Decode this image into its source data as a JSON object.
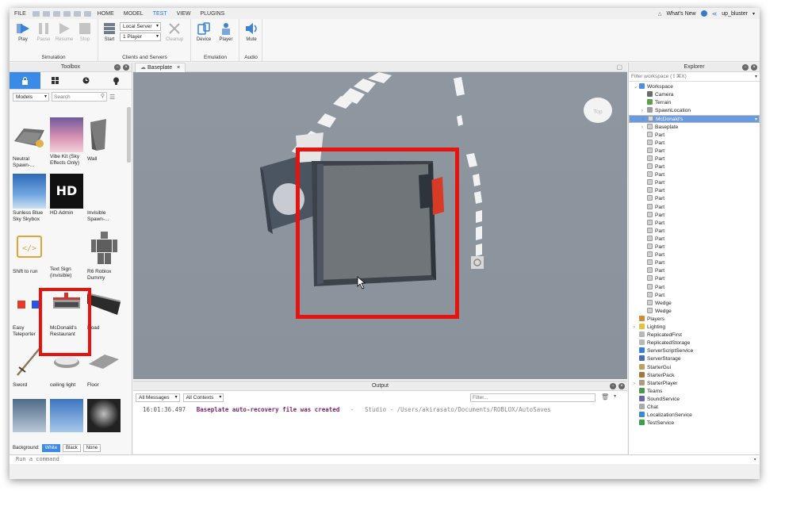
{
  "menu": {
    "file": "FILE",
    "tabs": [
      "HOME",
      "MODEL",
      "TEST",
      "VIEW",
      "PLUGINS"
    ],
    "active_tab": "TEST",
    "whats_new": "What's New",
    "username": "up_bluster"
  },
  "ribbon": {
    "play": "Play",
    "pause": "Pause",
    "resume": "Resume",
    "stop": "Stop",
    "simulation_label": "Simulation",
    "start": "Start",
    "server_select": "Local Server",
    "players_select": "1 Player",
    "cleanup": "Cleanup",
    "clients_label": "Clients and Servers",
    "device": "Device",
    "player": "Player",
    "emulation_label": "Emulation",
    "mute": "Mute",
    "audio_label": "Audio"
  },
  "toolbox": {
    "title": "Toolbox",
    "category": "Models",
    "search_placeholder": "Search",
    "items": [
      {
        "label": "Neutral Spawn-..."
      },
      {
        "label": "Vibe Kit (Sky Effects Only)"
      },
      {
        "label": "Wall"
      },
      {
        "label": "Sunless Blue Sky Skybox"
      },
      {
        "label": "HD Admin"
      },
      {
        "label": "Invisible Spawn-..."
      },
      {
        "label": "Shift to run"
      },
      {
        "label": "Text Sign (invisible)"
      },
      {
        "label": "R6 Roblox Dummy"
      },
      {
        "label": "Easy Teleporter"
      },
      {
        "label": "McDonald's Restaurant"
      },
      {
        "label": "Road"
      },
      {
        "label": "Sword"
      },
      {
        "label": "ceiling light"
      },
      {
        "label": "Floor"
      }
    ],
    "thumb_text_hd": "HD",
    "background_label": "Background:",
    "bg_white": "White",
    "bg_black": "Black",
    "bg_none": "None"
  },
  "viewport": {
    "tab_label": "Baseplate"
  },
  "output": {
    "title": "Output",
    "messages_filter": "All Messages",
    "contexts_filter": "All Contexts",
    "filter_placeholder": "Filter...",
    "line": {
      "time": "16:01:36.497",
      "message": "Baseplate auto-recovery file was created",
      "separator": "-",
      "source": "Studio - /Users/akirasato/Documents/ROBLOX/AutoSaves"
    }
  },
  "explorer": {
    "title": "Explorer",
    "filter_placeholder": "Filter workspace (⇧⌘X)",
    "tree": [
      {
        "label": "Workspace",
        "depth": 0,
        "arrow": "⌄",
        "icon": "workspace",
        "selected": false
      },
      {
        "label": "Camera",
        "depth": 1,
        "arrow": "",
        "icon": "camera",
        "selected": false
      },
      {
        "label": "Terrain",
        "depth": 1,
        "arrow": "",
        "icon": "terrain",
        "selected": false
      },
      {
        "label": "SpawnLocation",
        "depth": 1,
        "arrow": "›",
        "icon": "spawn",
        "selected": false
      },
      {
        "label": "McDonald's",
        "depth": 1,
        "arrow": "›",
        "icon": "model",
        "selected": true
      },
      {
        "label": "Baseplate",
        "depth": 1,
        "arrow": "›",
        "icon": "part",
        "selected": false
      },
      {
        "label": "Part",
        "depth": 1,
        "arrow": "",
        "icon": "part",
        "selected": false
      },
      {
        "label": "Part",
        "depth": 1,
        "arrow": "",
        "icon": "part",
        "selected": false
      },
      {
        "label": "Part",
        "depth": 1,
        "arrow": "",
        "icon": "part",
        "selected": false
      },
      {
        "label": "Part",
        "depth": 1,
        "arrow": "",
        "icon": "part",
        "selected": false
      },
      {
        "label": "Part",
        "depth": 1,
        "arrow": "",
        "icon": "part",
        "selected": false
      },
      {
        "label": "Part",
        "depth": 1,
        "arrow": "",
        "icon": "part",
        "selected": false
      },
      {
        "label": "Part",
        "depth": 1,
        "arrow": "",
        "icon": "part",
        "selected": false
      },
      {
        "label": "Part",
        "depth": 1,
        "arrow": "",
        "icon": "part",
        "selected": false
      },
      {
        "label": "Part",
        "depth": 1,
        "arrow": "",
        "icon": "part",
        "selected": false
      },
      {
        "label": "Part",
        "depth": 1,
        "arrow": "",
        "icon": "part",
        "selected": false
      },
      {
        "label": "Part",
        "depth": 1,
        "arrow": "",
        "icon": "part",
        "selected": false
      },
      {
        "label": "Part",
        "depth": 1,
        "arrow": "",
        "icon": "part",
        "selected": false
      },
      {
        "label": "Part",
        "depth": 1,
        "arrow": "",
        "icon": "part",
        "selected": false
      },
      {
        "label": "Part",
        "depth": 1,
        "arrow": "",
        "icon": "part",
        "selected": false
      },
      {
        "label": "Part",
        "depth": 1,
        "arrow": "",
        "icon": "part",
        "selected": false
      },
      {
        "label": "Part",
        "depth": 1,
        "arrow": "",
        "icon": "part",
        "selected": false
      },
      {
        "label": "Part",
        "depth": 1,
        "arrow": "",
        "icon": "part",
        "selected": false
      },
      {
        "label": "Part",
        "depth": 1,
        "arrow": "",
        "icon": "part",
        "selected": false
      },
      {
        "label": "Part",
        "depth": 1,
        "arrow": "",
        "icon": "part",
        "selected": false
      },
      {
        "label": "Part",
        "depth": 1,
        "arrow": "",
        "icon": "part",
        "selected": false
      },
      {
        "label": "Part",
        "depth": 1,
        "arrow": "",
        "icon": "part",
        "selected": false
      },
      {
        "label": "Wedge",
        "depth": 1,
        "arrow": "",
        "icon": "part",
        "selected": false
      },
      {
        "label": "Wedge",
        "depth": 1,
        "arrow": "",
        "icon": "part",
        "selected": false
      },
      {
        "label": "Players",
        "depth": 0,
        "arrow": "",
        "icon": "players",
        "selected": false
      },
      {
        "label": "Lighting",
        "depth": 0,
        "arrow": "›",
        "icon": "lighting",
        "selected": false
      },
      {
        "label": "ReplicatedFirst",
        "depth": 0,
        "arrow": "",
        "icon": "replicated",
        "selected": false
      },
      {
        "label": "ReplicatedStorage",
        "depth": 0,
        "arrow": "",
        "icon": "replicated",
        "selected": false
      },
      {
        "label": "ServerScriptService",
        "depth": 0,
        "arrow": "",
        "icon": "script",
        "selected": false
      },
      {
        "label": "ServerStorage",
        "depth": 0,
        "arrow": "",
        "icon": "storage",
        "selected": false
      },
      {
        "label": "StarterGui",
        "depth": 0,
        "arrow": "",
        "icon": "gui",
        "selected": false
      },
      {
        "label": "StarterPack",
        "depth": 0,
        "arrow": "",
        "icon": "pack",
        "selected": false
      },
      {
        "label": "StarterPlayer",
        "depth": 0,
        "arrow": "›",
        "icon": "player",
        "selected": false
      },
      {
        "label": "Teams",
        "depth": 0,
        "arrow": "",
        "icon": "teams",
        "selected": false
      },
      {
        "label": "SoundService",
        "depth": 0,
        "arrow": "",
        "icon": "sound",
        "selected": false
      },
      {
        "label": "Chat",
        "depth": 0,
        "arrow": "",
        "icon": "chat",
        "selected": false
      },
      {
        "label": "LocalizationService",
        "depth": 0,
        "arrow": "",
        "icon": "locale",
        "selected": false
      },
      {
        "label": "TestService",
        "depth": 0,
        "arrow": "",
        "icon": "test",
        "selected": false
      }
    ]
  },
  "command_bar": {
    "placeholder": "Run a command"
  },
  "colors": {
    "accent": "#3b8ae6",
    "highlight_red": "#e8120f",
    "selection": "#6a9be0"
  }
}
